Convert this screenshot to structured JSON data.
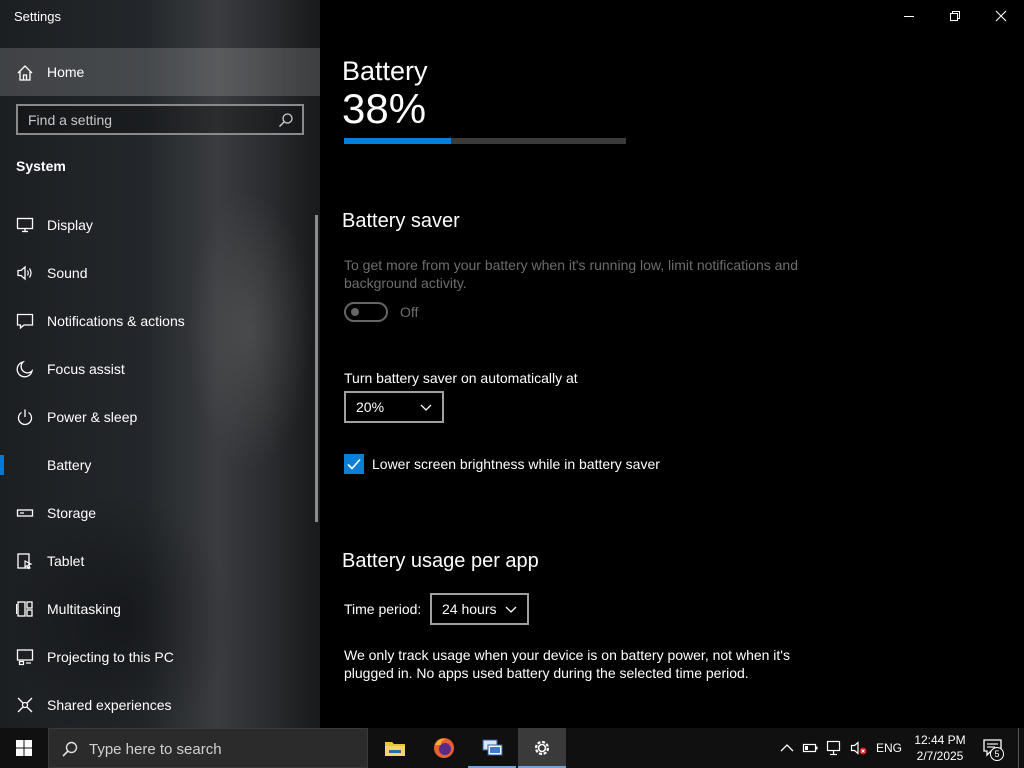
{
  "window": {
    "title": "Settings",
    "controls": {
      "minimize": "minimize",
      "restore": "restore",
      "close": "close"
    }
  },
  "sidebar": {
    "home_label": "Home",
    "search_placeholder": "Find a setting",
    "section": "System",
    "items": [
      {
        "label": "Display",
        "icon": "display-icon"
      },
      {
        "label": "Sound",
        "icon": "sound-icon"
      },
      {
        "label": "Notifications & actions",
        "icon": "notifications-icon"
      },
      {
        "label": "Focus assist",
        "icon": "focus-assist-icon"
      },
      {
        "label": "Power & sleep",
        "icon": "power-icon"
      },
      {
        "label": "Battery",
        "icon": "battery-icon",
        "active": true
      },
      {
        "label": "Storage",
        "icon": "storage-icon"
      },
      {
        "label": "Tablet",
        "icon": "tablet-icon"
      },
      {
        "label": "Multitasking",
        "icon": "multitasking-icon"
      },
      {
        "label": "Projecting to this PC",
        "icon": "projecting-icon"
      },
      {
        "label": "Shared experiences",
        "icon": "shared-experiences-icon"
      }
    ]
  },
  "main": {
    "title": "Battery",
    "percent": "38%",
    "level": 0.38,
    "saver": {
      "heading": "Battery saver",
      "description": "To get more from your battery when it's running low, limit notifications and background activity.",
      "toggle_state": "Off",
      "auto_label": "Turn battery saver on automatically at",
      "auto_value": "20%",
      "brightness_label": "Lower screen brightness while in battery saver",
      "brightness_checked": true
    },
    "usage": {
      "heading": "Battery usage per app",
      "period_label": "Time period:",
      "period_value": "24 hours",
      "description": "We only track usage when your device is on battery power, not when it's plugged in. No apps used battery during the selected time period."
    }
  },
  "taskbar": {
    "search_placeholder": "Type here to search",
    "apps": [
      "file-explorer-icon",
      "firefox-icon",
      "network-app-icon",
      "settings-icon"
    ],
    "language": "ENG",
    "time": "12:44 PM",
    "date": "2/7/2025",
    "notification_count": "5"
  },
  "colors": {
    "accent": "#0078d7",
    "background": "#000000",
    "dim_text": "#6d6d6d"
  }
}
